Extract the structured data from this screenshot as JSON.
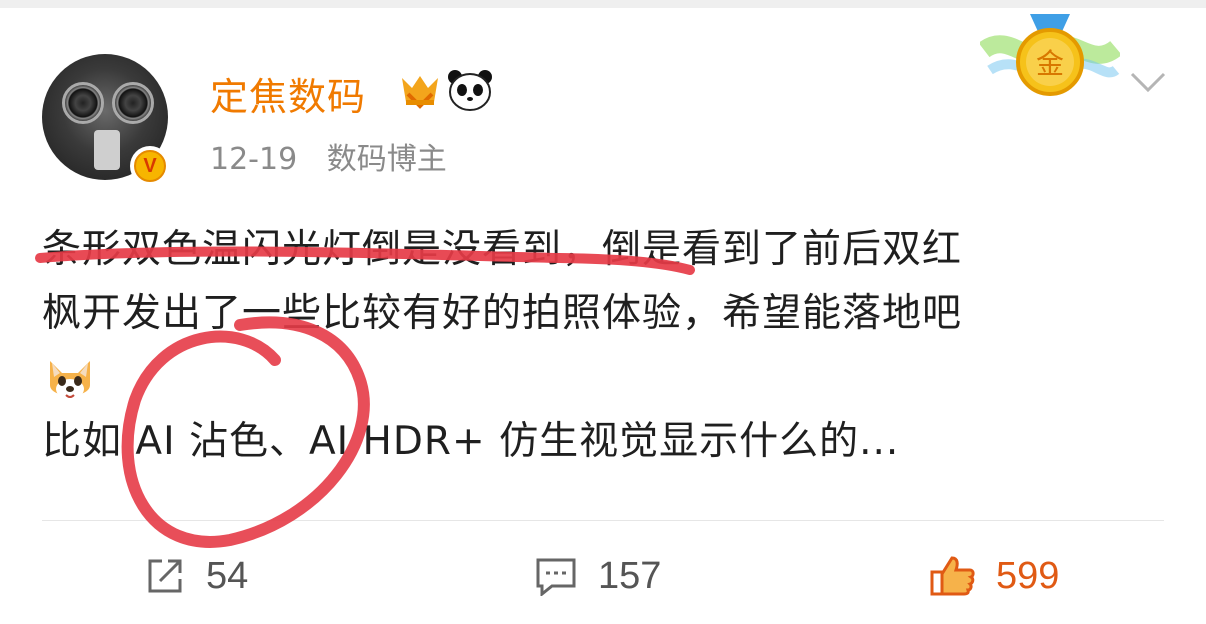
{
  "post": {
    "username": "定焦数码",
    "date": "12-19",
    "account_type": "数码博主",
    "text_lines": [
      "条形双色温闪光灯倒是没看到，倒是看到了前后双红",
      "枫开发出了一些比较有好的拍照体验，希望能落地吧",
      "",
      "比如 AI 沾色、AI HDR+ 仿生视觉显示什么的..."
    ],
    "medal_label": "金"
  },
  "actions": {
    "share_count": "54",
    "comment_count": "157",
    "like_count": "599"
  },
  "colors": {
    "username": "#f07a00",
    "like": "#e05a14",
    "annotation": "#e63b47"
  },
  "icons": {
    "vip": "vip-badge-icon",
    "panda": "panda-icon",
    "verified": "verified-v-icon",
    "medal": "gold-medal-icon",
    "chevron": "chevron-down-icon",
    "share": "share-icon",
    "comment": "comment-icon",
    "like": "thumbs-up-icon",
    "dog": "dog-emoji-icon"
  }
}
